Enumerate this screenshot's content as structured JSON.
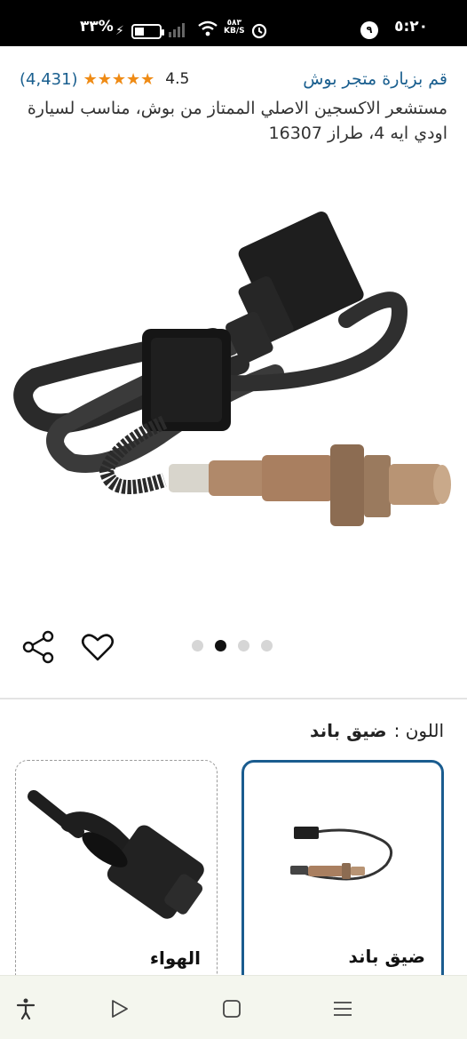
{
  "status_bar": {
    "time": "٥:٢٠",
    "notification_count": "٩",
    "battery_percent": "%٣٣",
    "network_speed_value": "٥٨٣",
    "network_speed_unit": "KB/S",
    "battery_level": 0.33
  },
  "header": {
    "store_link": "قم بزيارة متجر بوش",
    "rating_score": "4.5",
    "rating_count": "(4,431)",
    "rating_value": 4.5,
    "title": "مستشعر الاكسجين الاصلي الممتاز من بوش، مناسب لسيارة اودي ايه 4، طراز 16307"
  },
  "gallery": {
    "image_count": 4,
    "active_index": 1,
    "image_icon": "oxygen-sensor-image"
  },
  "actions": {
    "share_icon": "share-icon",
    "favorite_icon": "heart-icon"
  },
  "color_selector": {
    "label": "اللون :",
    "selected_value": "ضيق باند"
  },
  "options": [
    {
      "label": "ضيق باند",
      "selected": true
    },
    {
      "label": "الهواء",
      "selected": false
    }
  ],
  "colors": {
    "accent_link": "#1a5f8f",
    "star": "#ef8b15",
    "selected_border": "#1a5c8f"
  },
  "nav_bar": {
    "icons": [
      "accessibility-icon",
      "play-icon",
      "home-square-icon",
      "menu-icon"
    ]
  }
}
